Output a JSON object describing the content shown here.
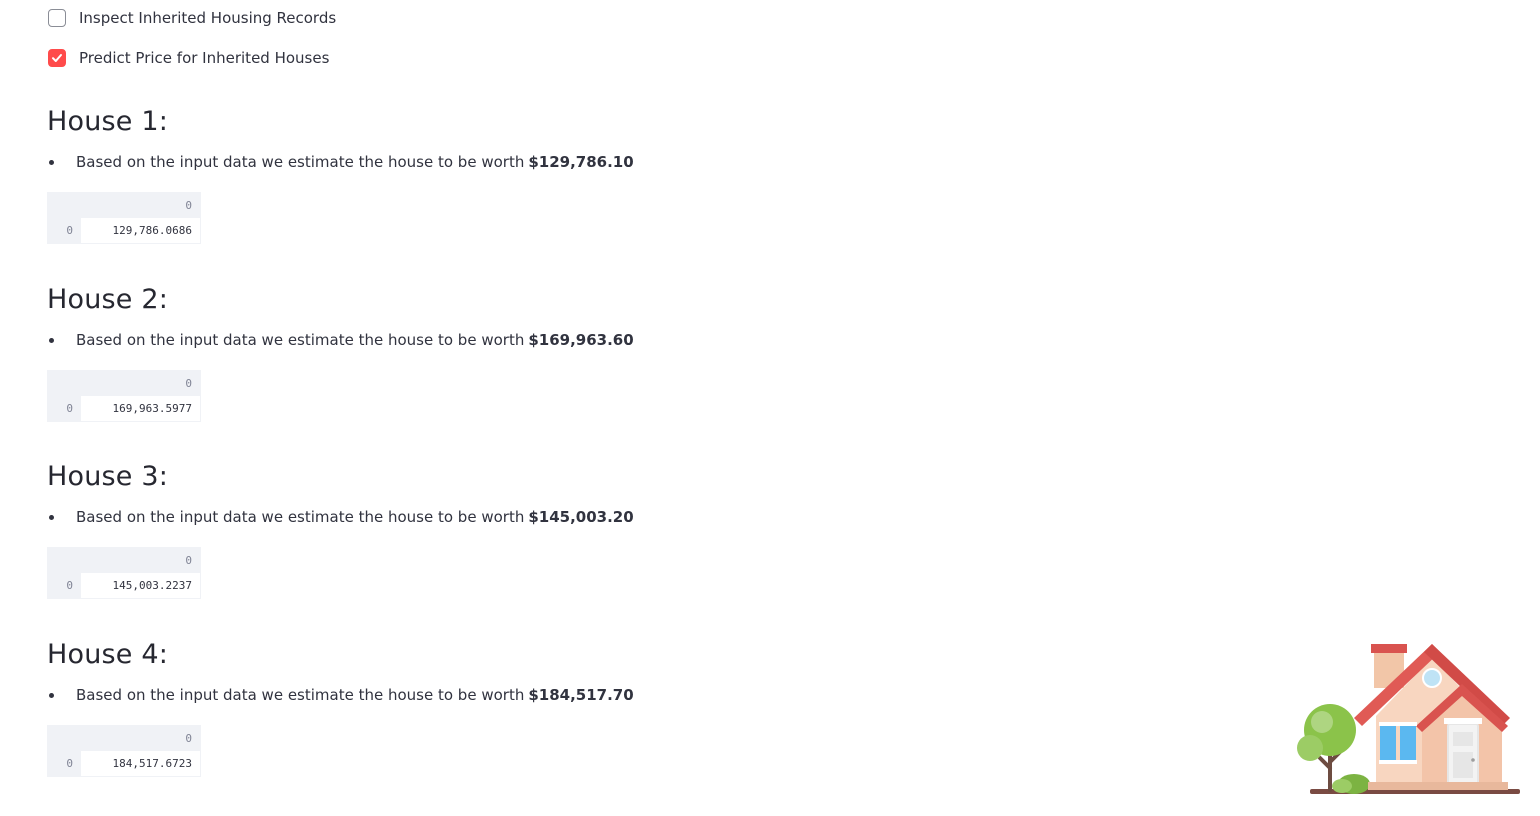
{
  "checkboxes": [
    {
      "label": "Inspect Inherited Housing Records",
      "checked": false
    },
    {
      "label": "Predict Price for Inherited Houses",
      "checked": true
    }
  ],
  "houses": [
    {
      "title": "House 1:",
      "estimate_text": "Based on the input data we estimate the house to be worth",
      "estimate_value": "$129,786.10",
      "table": {
        "column_header": "0",
        "row_index": "0",
        "value": "129,786.0686"
      }
    },
    {
      "title": "House 2:",
      "estimate_text": "Based on the input data we estimate the house to be worth",
      "estimate_value": "$169,963.60",
      "table": {
        "column_header": "0",
        "row_index": "0",
        "value": "169,963.5977"
      }
    },
    {
      "title": "House 3:",
      "estimate_text": "Based on the input data we estimate the house to be worth",
      "estimate_value": "$145,003.20",
      "table": {
        "column_header": "0",
        "row_index": "0",
        "value": "145,003.2237"
      }
    },
    {
      "title": "House 4:",
      "estimate_text": "Based on the input data we estimate the house to be worth",
      "estimate_value": "$184,517.70",
      "table": {
        "column_header": "0",
        "row_index": "0",
        "value": "184,517.6723"
      }
    }
  ],
  "theme": {
    "checkbox_accent": "#ff4b4b",
    "table_header_bg": "#f0f2f6",
    "text_color": "#31333f"
  },
  "illustration": {
    "icon": "house-with-tree-icon"
  }
}
